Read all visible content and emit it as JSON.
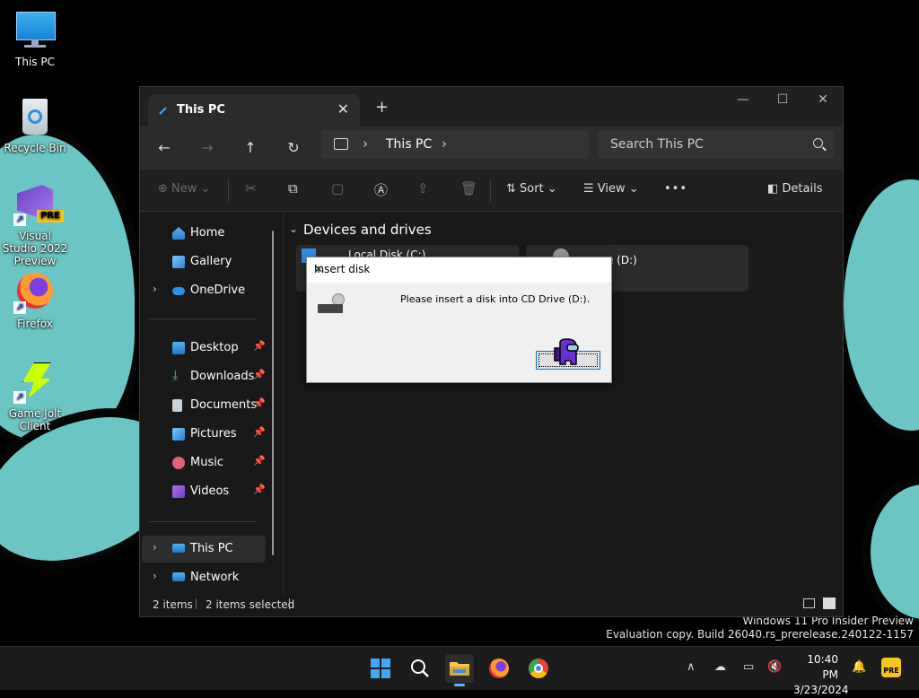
{
  "desktop": {
    "icons": [
      {
        "label": "This PC"
      },
      {
        "label": "Recycle Bin"
      },
      {
        "label": "Visual Studio 2022 Preview",
        "badge": "PRE"
      },
      {
        "label": "Firefox"
      },
      {
        "label": "Game Jolt Client"
      }
    ],
    "watermark": {
      "line1": "Windows 11 Pro Insider Preview",
      "line2": "Evaluation copy. Build 26040.rs_prerelease.240122-1157"
    }
  },
  "explorer": {
    "tab": {
      "title": "This PC",
      "close": "✕"
    },
    "newtab": "+",
    "window_controls": {
      "minimize": "—",
      "maximize": "☐",
      "close": "✕"
    },
    "nav": {
      "back": "←",
      "forward": "→",
      "up": "↑",
      "refresh": "↻"
    },
    "address": {
      "sep": "›",
      "crumb": "This PC"
    },
    "search": {
      "placeholder": "Search This PC"
    },
    "command_bar": {
      "new": "New",
      "sort": "Sort",
      "view": "View",
      "more": "•••",
      "details": "Details"
    },
    "sidebar": {
      "home": "Home",
      "gallery": "Gallery",
      "onedrive": "OneDrive",
      "desktop": "Desktop",
      "downloads": "Downloads",
      "documents": "Documents",
      "pictures": "Pictures",
      "music": "Music",
      "videos": "Videos",
      "this_pc": "This PC",
      "network": "Network"
    },
    "content": {
      "group_title": "Devices and drives",
      "drives": [
        {
          "name": "Local Disk (C:)"
        },
        {
          "name": "CD Drive (D:)",
          "visible_name": "e (D:)"
        }
      ]
    },
    "status": {
      "items": "2 items",
      "selected": "2 items selected"
    }
  },
  "dialog": {
    "title": "Insert disk",
    "message": "Please insert a disk into CD Drive (D:).",
    "close": "✕"
  },
  "taskbar": {
    "clock_time": "10:40 PM",
    "clock_date": "3/23/2024",
    "chevron": "∧"
  },
  "colors": {
    "accent": "#0078d4",
    "wallpaper_blob": "#6cc5c5",
    "explorer_bg": "#191919"
  }
}
